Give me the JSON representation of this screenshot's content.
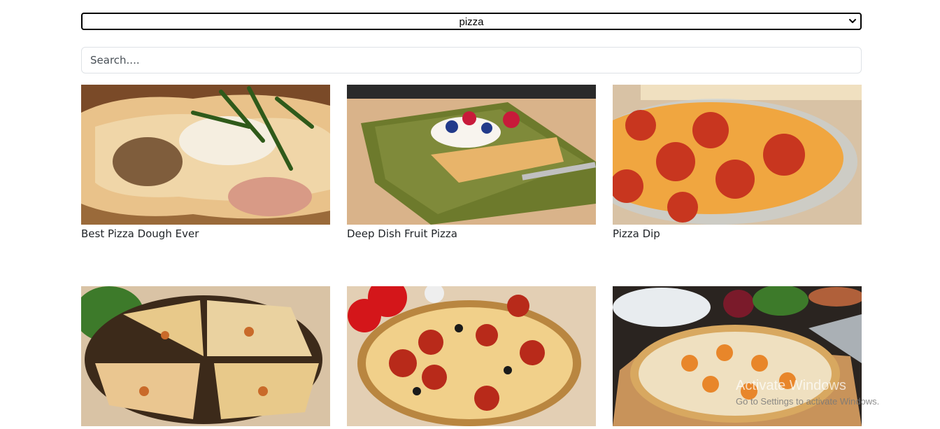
{
  "category_select": {
    "selected": "pizza"
  },
  "search": {
    "placeholder": "Search...."
  },
  "recipes": [
    {
      "title": "Best Pizza Dough Ever"
    },
    {
      "title": "Deep Dish Fruit Pizza"
    },
    {
      "title": "Pizza Dip"
    },
    {
      "title": ""
    },
    {
      "title": ""
    },
    {
      "title": ""
    }
  ],
  "watermark": {
    "line1": "Activate Windows",
    "line2": "Go to Settings to activate Windows."
  }
}
